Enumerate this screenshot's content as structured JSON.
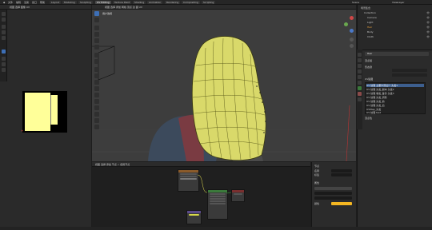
{
  "topbar": {
    "menu": [
      "文件",
      "编辑",
      "渲染",
      "窗口",
      "帮助"
    ],
    "tabs": [
      "Layout",
      "Modeling",
      "Sculpting",
      "UV Editing",
      "Texture Paint",
      "Shading",
      "Animation",
      "Rendering",
      "Compositing",
      "Scripting"
    ],
    "active_tab": 3,
    "scene": "Scene",
    "view_layer": "ViewLayer"
  },
  "uv_editor": {
    "header": "视图  选择  图像  UV"
  },
  "viewport": {
    "header": "视图  选择  添加  网格  顶点  边  面  UV",
    "label": "用户透视"
  },
  "node_editor": {
    "header": "视图  选择  添加  节点   ✓ 使用节点"
  },
  "node_sidebar": {
    "rows": [
      "节点",
      "名称",
      "标签",
      "属性",
      "颜色"
    ],
    "accent": "#f5b722"
  },
  "outliner": {
    "rows": [
      "场景集合",
      "Collection",
      "Camera",
      "Light",
      "Hair",
      "Body",
      "Cloth"
    ]
  },
  "properties": {
    "object_name": "Hair",
    "sections": [
      "顶点组",
      "形态键",
      "UV贴图"
    ],
    "uv_list": [
      "UV 纹理 主要外观设计 头发1",
      "UV 纹理 头发_副本 头发2",
      "UV 纹理 卷发_备份 头发3 ",
      "UV 纹理 头发_调整",
      "UV 纹理 头发_前",
      "UV 纹理 头发_后",
      "UVMap_头发",
      "UV 纹理 test"
    ],
    "footer": "顶点色"
  },
  "colors": {
    "hair": "#d9d96a",
    "accent_blue": "#3d6fb6",
    "uv_yellow": "#ffff99"
  }
}
